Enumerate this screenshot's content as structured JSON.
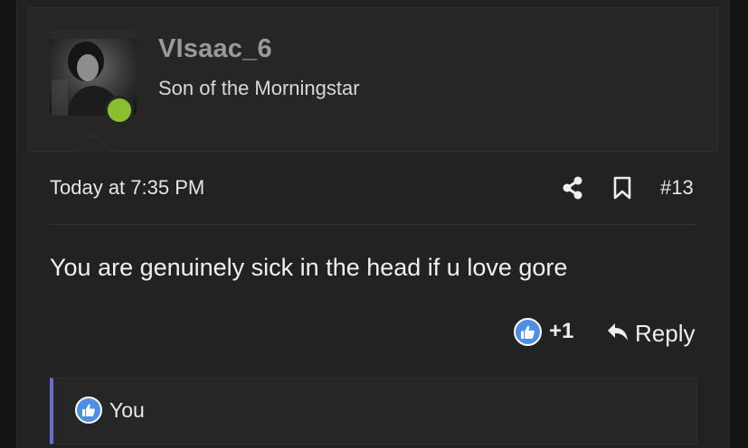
{
  "user": {
    "username": "VIsaac_6",
    "title": "Son of the Morningstar",
    "online_status_color": "#8cbf2e"
  },
  "post": {
    "timestamp": "Today at 7:35 PM",
    "number": "#13",
    "message": "You are genuinely sick in the head if u love gore",
    "actions": {
      "share_icon": "share-icon",
      "bookmark_icon": "bookmark-icon"
    }
  },
  "footer": {
    "like_icon": "thumbs-up-icon",
    "like_count": "+1",
    "reply_label": "Reply",
    "reply_icon": "reply-arrow-icon"
  },
  "reactions": {
    "icon": "thumbs-up-icon",
    "users": "You",
    "accent_color": "#6b6bd0"
  },
  "colors": {
    "background": "#222222",
    "text": "#f0f0f0",
    "like_blue": "#4d8fe6"
  }
}
